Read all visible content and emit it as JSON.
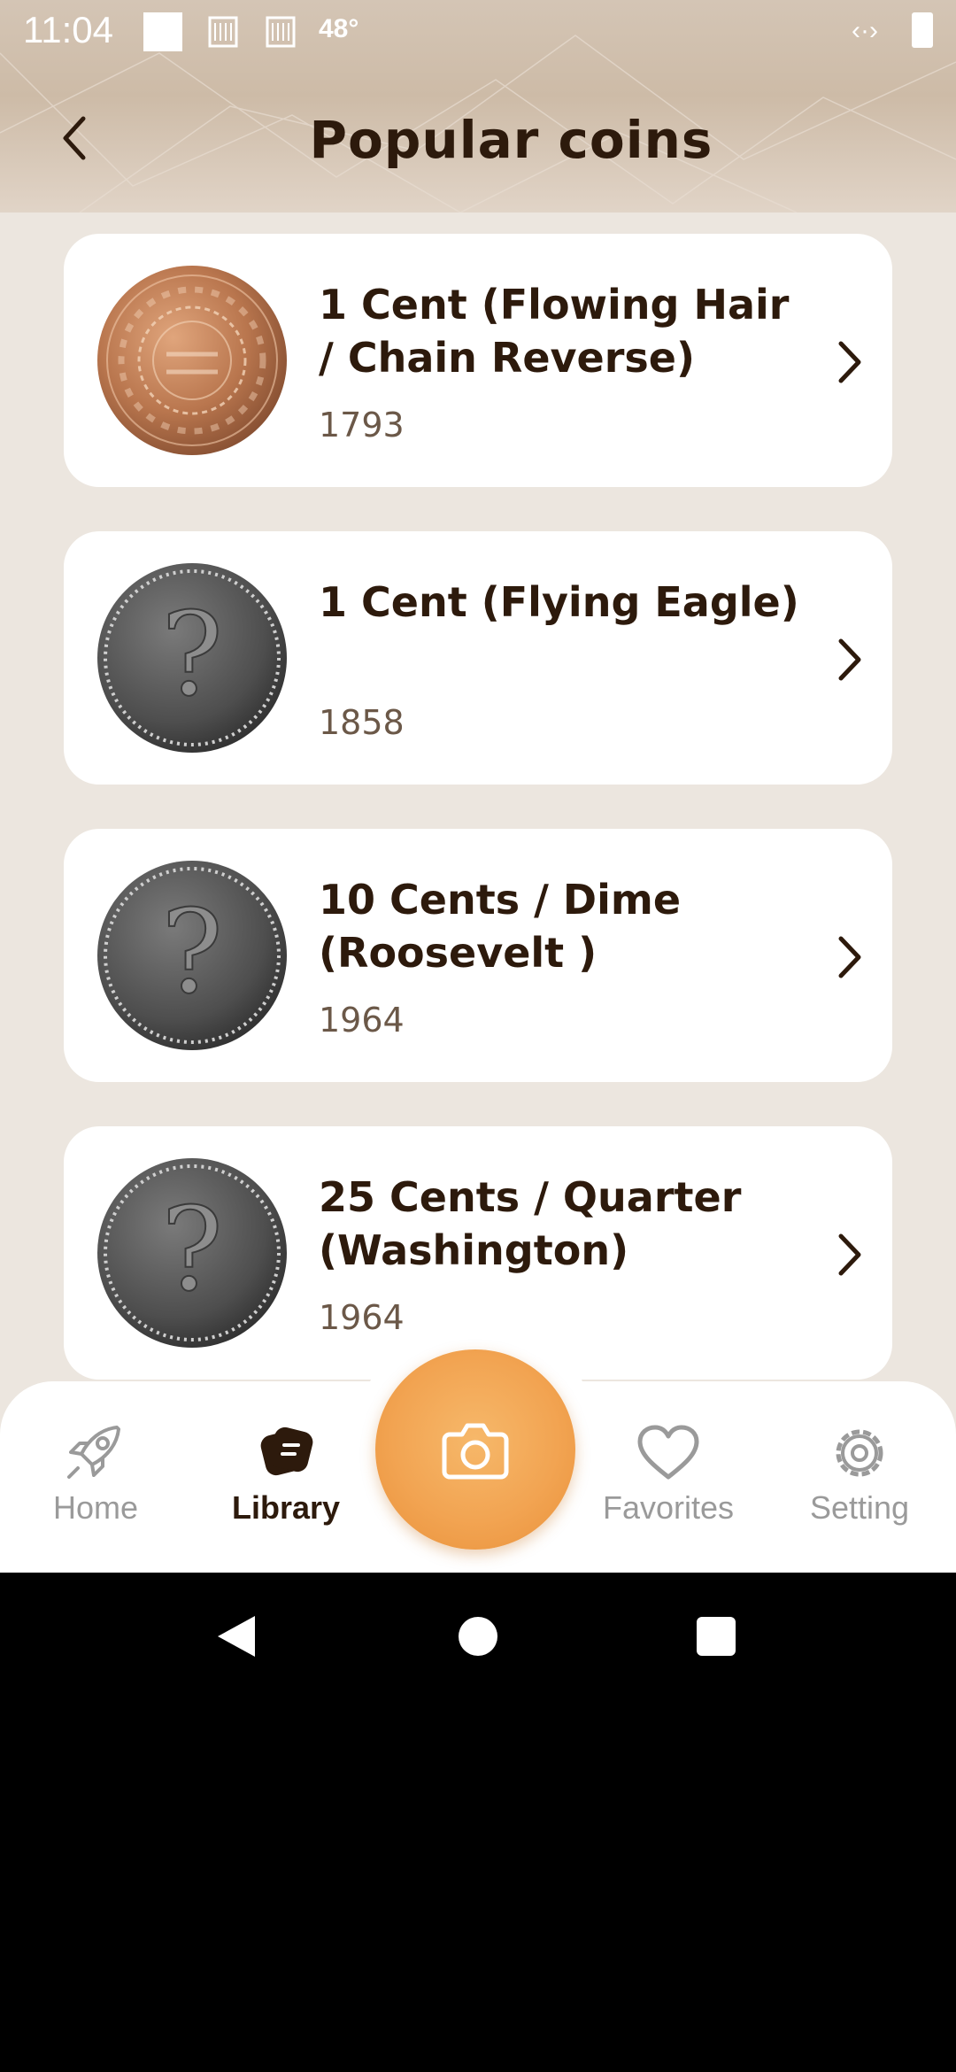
{
  "status_bar": {
    "time": "11:04",
    "temperature": "48°"
  },
  "header": {
    "title": "Popular coins",
    "back_icon": "chevron-left-icon"
  },
  "coins": [
    {
      "name": "1 Cent (Flowing Hair / Chain Reverse)",
      "year": "1793",
      "image": "copper-coin"
    },
    {
      "name": "1 Cent (Flying Eagle)",
      "year": "1858",
      "image": "placeholder-coin"
    },
    {
      "name": "10 Cents / Dime (Roosevelt )",
      "year": "1964",
      "image": "placeholder-coin"
    },
    {
      "name": "25 Cents / Quarter (Washington)",
      "year": "1964",
      "image": "placeholder-coin"
    }
  ],
  "bottom_nav": {
    "home": "Home",
    "library": "Library",
    "favorites": "Favorites",
    "setting": "Setting",
    "active": "Library"
  },
  "colors": {
    "accent": "#f2a452",
    "text_dark": "#2d1a0c",
    "background": "#ece6df"
  }
}
